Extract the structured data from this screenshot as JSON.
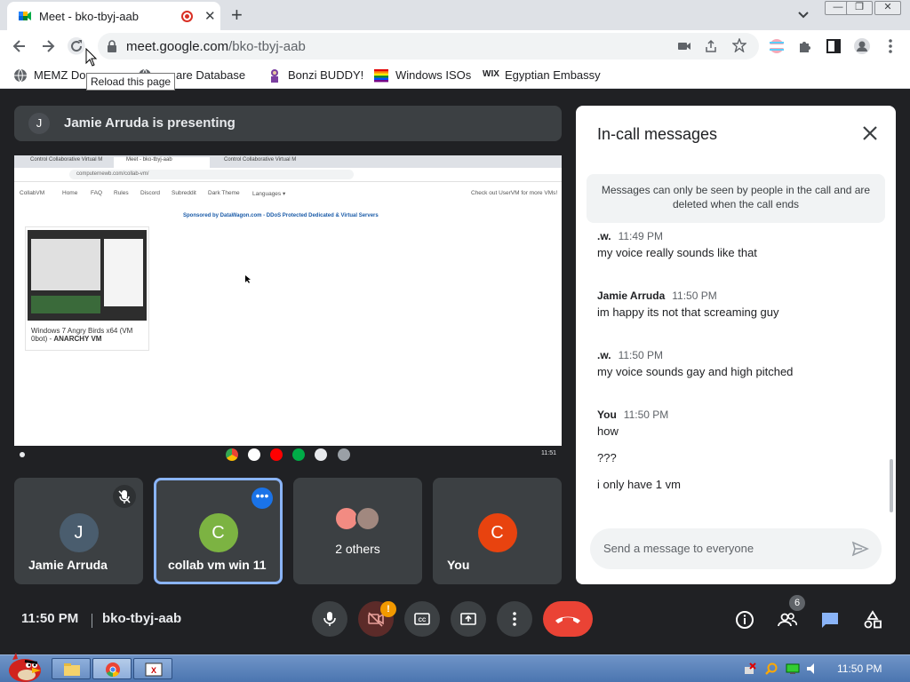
{
  "browser": {
    "tab_title": "Meet - bko-tbyj-aab",
    "tab_close": "✕",
    "new_tab": "+",
    "url_host": "meet.google.com",
    "url_path": "/bko-tbyj-aab",
    "tooltip": "Reload this page",
    "window_buttons": [
      "—",
      "❐",
      "✕"
    ],
    "bookmarks": [
      {
        "label": "MEMZ Do",
        "icon": "globe-icon"
      },
      {
        "label": "are Database",
        "icon": "globe-icon"
      },
      {
        "label": "Bonzi BUDDY!",
        "icon": "bonzi-icon"
      },
      {
        "label": "Windows ISOs",
        "icon": "rainbow-flag-icon"
      },
      {
        "label": "Egyptian Embassy",
        "icon": "wix-icon"
      }
    ]
  },
  "presenting": {
    "avatar_letter": "J",
    "text": "Jamie Arruda is presenting"
  },
  "shared_screen": {
    "tabs": [
      "Control Collaborative Virtual M",
      "Meet - bko-tbyj-aab",
      "Control Collaborative Virtual M"
    ],
    "url": "computernewb.com/collab-vm/",
    "nav": [
      "CollabVM",
      "Home",
      "FAQ",
      "Rules",
      "Discord",
      "Subreddit",
      "Dark Theme",
      "Languages ▾"
    ],
    "nav_right": "Check out UserVM for more VMs!",
    "sponsor": "Sponsored by DataWagon.com - DDoS Protected Dedicated & Virtual Servers",
    "vm_caption": "Windows 7 Angry Birds x64 (VM 0bot) -",
    "vm_caption_bold": "ANARCHY VM",
    "clock": "11:51"
  },
  "participants": [
    {
      "letter": "J",
      "name": "Jamie Arruda",
      "color": "#4a5d6e",
      "muted": true
    },
    {
      "letter": "C",
      "name": "collab vm win 11",
      "color": "#7cb342",
      "active": true
    },
    {
      "label": "2 others"
    },
    {
      "letter": "C",
      "name": "You",
      "color": "#e8430f"
    }
  ],
  "chat": {
    "title": "In-call messages",
    "notice": "Messages can only be seen by people in the call and are deleted when the call ends",
    "messages": [
      {
        "sender": ".w.",
        "time": "11:49 PM",
        "lines": [
          "my voice really sounds like that"
        ]
      },
      {
        "sender": "Jamie Arruda",
        "time": "11:50 PM",
        "lines": [
          "im happy its not that screaming guy"
        ]
      },
      {
        "sender": ".w.",
        "time": "11:50 PM",
        "lines": [
          "my voice sounds gay and high pitched"
        ]
      },
      {
        "sender": "You",
        "time": "11:50 PM",
        "lines": [
          "how",
          "???",
          "i only have 1 vm"
        ]
      }
    ],
    "placeholder": "Send a message to everyone"
  },
  "bottom_bar": {
    "time": "11:50 PM",
    "meeting_code": "bko-tbyj-aab",
    "camera_warning": "!",
    "people_count": "6"
  },
  "taskbar": {
    "time": "11:50 PM"
  },
  "colors": {
    "meet_bg": "#202124",
    "tile_bg": "#3c4043",
    "end_call": "#ea4335",
    "accent": "#8ab4f8",
    "chat_active": "#1a73e8"
  }
}
